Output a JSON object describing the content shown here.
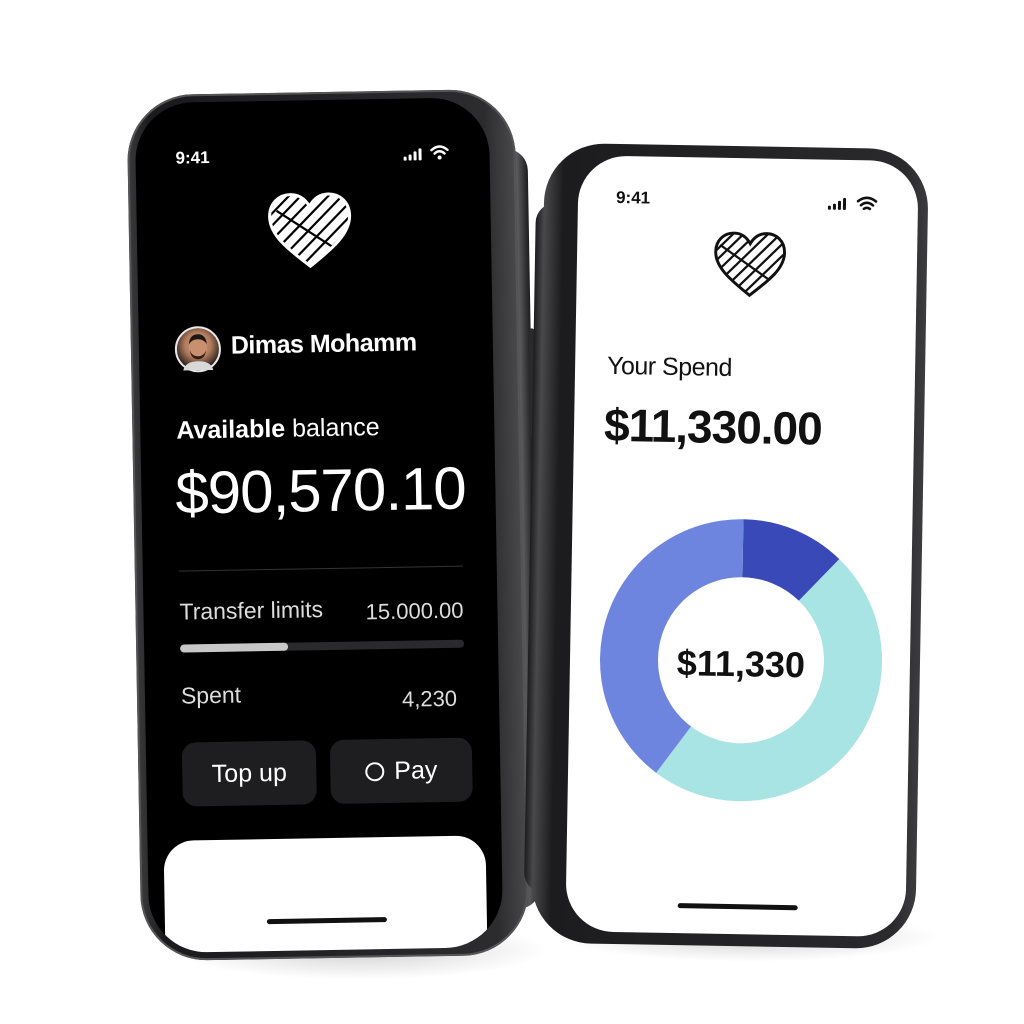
{
  "dark_phone": {
    "status_time": "9:41",
    "user_name": "Dimas Mohamm",
    "balance_label_bold": "Available",
    "balance_label_rest": " balance",
    "balance_amount": "$90,570.10",
    "transfer_limits_label": "Transfer limits",
    "transfer_limits_value": "15.000.00",
    "spent_label": "Spent",
    "spent_value": "4,230",
    "spent_progress_fraction": 0.38,
    "top_up_label": "Top up",
    "pay_label": "Pay"
  },
  "light_phone": {
    "status_time": "9:41",
    "title": "Your Spend",
    "amount": "$11,330.00",
    "donut_center_label": "$11,330"
  },
  "chart_data": {
    "type": "pie",
    "style": "donut",
    "center_label": "$11,330",
    "slices": [
      {
        "value": 0.12,
        "color": "#3a49b8"
      },
      {
        "value": 0.48,
        "color": "#a8e4e4"
      },
      {
        "value": 0.4,
        "color": "#6e85e0"
      }
    ]
  },
  "icons": [
    "signal-icon",
    "wifi-icon",
    "heart-logo-icon",
    "avatar",
    "circle-icon"
  ]
}
